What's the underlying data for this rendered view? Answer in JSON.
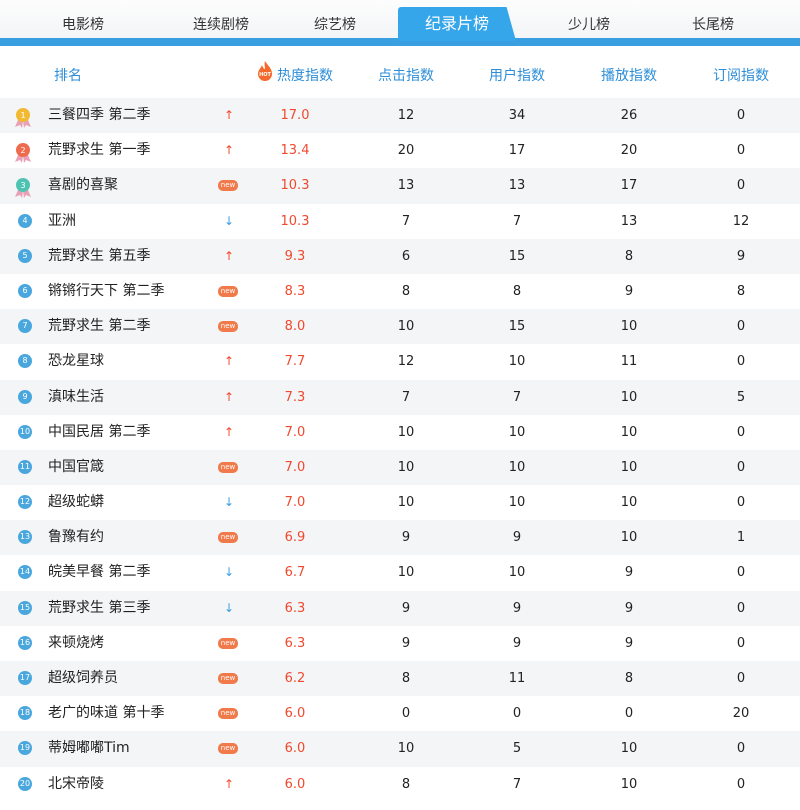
{
  "tabs": [
    "电影榜",
    "连续剧榜",
    "综艺榜",
    "纪录片榜",
    "少儿榜",
    "长尾榜"
  ],
  "active_tab": "纪录片榜",
  "columns": {
    "rank_name": "排名",
    "hot_badge": "HOT",
    "heat": "热度指数",
    "click": "点击指数",
    "user": "用户指数",
    "play": "播放指数",
    "subscribe": "订阅指数"
  },
  "colors": {
    "accent": "#3a9fe0",
    "heat": "#f0492e",
    "new_tag": "#f07a4a",
    "header_text": "#2e8ed8"
  },
  "rows": [
    {
      "rank": "1",
      "name": "三餐四季 第二季",
      "trend": "up",
      "heat": "17.0",
      "click": "12",
      "user": "34",
      "play": "26",
      "subscribe": "0"
    },
    {
      "rank": "2",
      "name": "荒野求生 第一季",
      "trend": "up",
      "heat": "13.4",
      "click": "20",
      "user": "17",
      "play": "20",
      "subscribe": "0"
    },
    {
      "rank": "3",
      "name": "喜剧的喜聚",
      "trend": "new",
      "heat": "10.3",
      "click": "13",
      "user": "13",
      "play": "17",
      "subscribe": "0"
    },
    {
      "rank": "4",
      "name": "亚洲",
      "trend": "down",
      "heat": "10.3",
      "click": "7",
      "user": "7",
      "play": "13",
      "subscribe": "12"
    },
    {
      "rank": "5",
      "name": "荒野求生 第五季",
      "trend": "up",
      "heat": "9.3",
      "click": "6",
      "user": "15",
      "play": "8",
      "subscribe": "9"
    },
    {
      "rank": "6",
      "name": "锵锵行天下 第二季",
      "trend": "new",
      "heat": "8.3",
      "click": "8",
      "user": "8",
      "play": "9",
      "subscribe": "8"
    },
    {
      "rank": "7",
      "name": "荒野求生 第二季",
      "trend": "new",
      "heat": "8.0",
      "click": "10",
      "user": "15",
      "play": "10",
      "subscribe": "0"
    },
    {
      "rank": "8",
      "name": "恐龙星球",
      "trend": "up",
      "heat": "7.7",
      "click": "12",
      "user": "10",
      "play": "11",
      "subscribe": "0"
    },
    {
      "rank": "9",
      "name": "滇味生活",
      "trend": "up",
      "heat": "7.3",
      "click": "7",
      "user": "7",
      "play": "10",
      "subscribe": "5"
    },
    {
      "rank": "10",
      "name": "中国民居 第二季",
      "trend": "up",
      "heat": "7.0",
      "click": "10",
      "user": "10",
      "play": "10",
      "subscribe": "0"
    },
    {
      "rank": "11",
      "name": "中国官箴",
      "trend": "new",
      "heat": "7.0",
      "click": "10",
      "user": "10",
      "play": "10",
      "subscribe": "0"
    },
    {
      "rank": "12",
      "name": "超级蛇蟒",
      "trend": "down",
      "heat": "7.0",
      "click": "10",
      "user": "10",
      "play": "10",
      "subscribe": "0"
    },
    {
      "rank": "13",
      "name": "鲁豫有约",
      "trend": "new",
      "heat": "6.9",
      "click": "9",
      "user": "9",
      "play": "10",
      "subscribe": "1"
    },
    {
      "rank": "14",
      "name": "皖美早餐 第二季",
      "trend": "down",
      "heat": "6.7",
      "click": "10",
      "user": "10",
      "play": "9",
      "subscribe": "0"
    },
    {
      "rank": "15",
      "name": "荒野求生 第三季",
      "trend": "down",
      "heat": "6.3",
      "click": "9",
      "user": "9",
      "play": "9",
      "subscribe": "0"
    },
    {
      "rank": "16",
      "name": "来顿烧烤",
      "trend": "new",
      "heat": "6.3",
      "click": "9",
      "user": "9",
      "play": "9",
      "subscribe": "0"
    },
    {
      "rank": "17",
      "name": "超级饲养员",
      "trend": "new",
      "heat": "6.2",
      "click": "8",
      "user": "11",
      "play": "8",
      "subscribe": "0"
    },
    {
      "rank": "18",
      "name": "老广的味道 第十季",
      "trend": "new",
      "heat": "6.0",
      "click": "0",
      "user": "0",
      "play": "0",
      "subscribe": "20"
    },
    {
      "rank": "19",
      "name": "蒂姆嘟嘟Tim",
      "trend": "new",
      "heat": "6.0",
      "click": "10",
      "user": "5",
      "play": "10",
      "subscribe": "0"
    },
    {
      "rank": "20",
      "name": "北宋帝陵",
      "trend": "up",
      "heat": "6.0",
      "click": "8",
      "user": "7",
      "play": "10",
      "subscribe": "0"
    }
  ],
  "new_label": "new",
  "trend_glyphs": {
    "up": "↑",
    "down": "↓"
  }
}
